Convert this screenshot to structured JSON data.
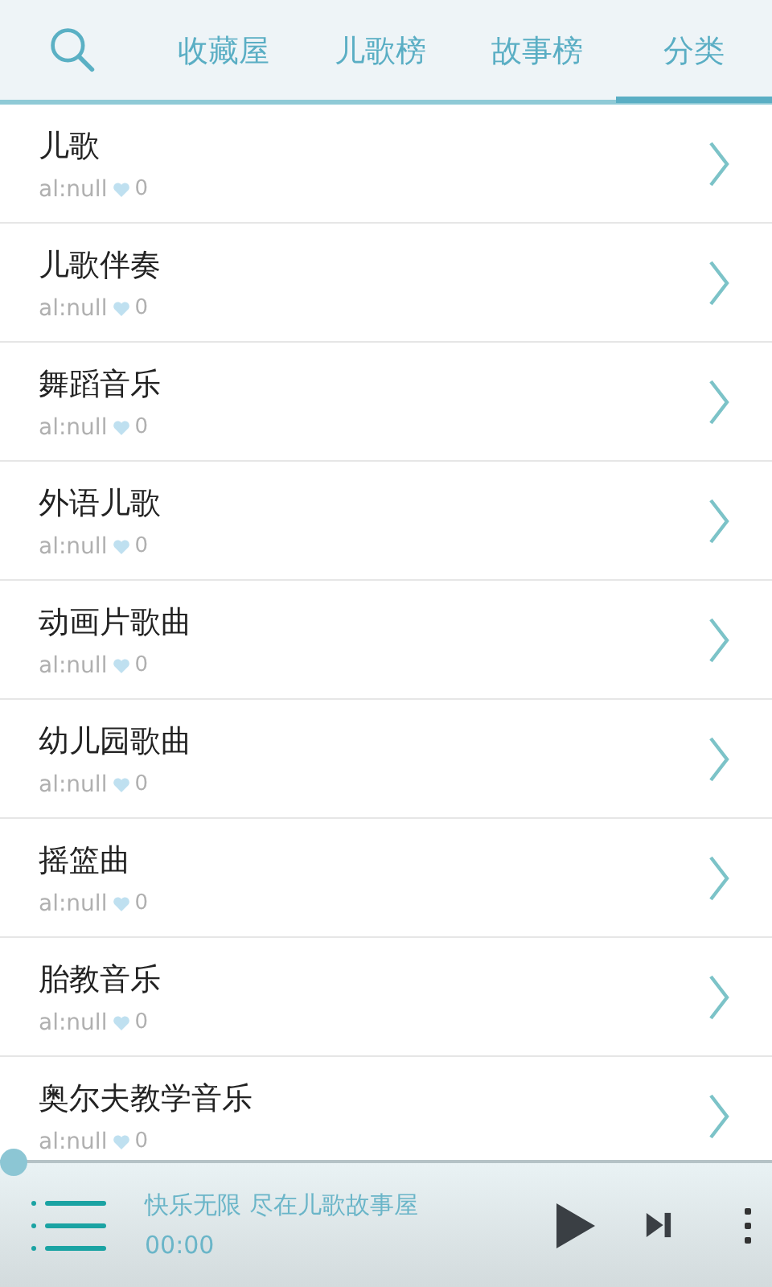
{
  "tabs": [
    {
      "label": "收藏屋",
      "selected": false
    },
    {
      "label": "儿歌榜",
      "selected": false
    },
    {
      "label": "故事榜",
      "selected": false
    },
    {
      "label": "分类",
      "selected": true
    }
  ],
  "categories": [
    {
      "title": "儿歌",
      "album": "al:null",
      "likes": "0"
    },
    {
      "title": "儿歌伴奏",
      "album": "al:null",
      "likes": "0"
    },
    {
      "title": "舞蹈音乐",
      "album": "al:null",
      "likes": "0"
    },
    {
      "title": "外语儿歌",
      "album": "al:null",
      "likes": "0"
    },
    {
      "title": "动画片歌曲",
      "album": "al:null",
      "likes": "0"
    },
    {
      "title": "幼儿园歌曲",
      "album": "al:null",
      "likes": "0"
    },
    {
      "title": "摇篮曲",
      "album": "al:null",
      "likes": "0"
    },
    {
      "title": "胎教音乐",
      "album": "al:null",
      "likes": "0"
    },
    {
      "title": "奥尔夫教学音乐",
      "album": "al:null",
      "likes": "0"
    }
  ],
  "player": {
    "progress": {
      "level": 0
    },
    "title": "快乐无限 尽在儿歌故事屋",
    "time": "00:00"
  }
}
